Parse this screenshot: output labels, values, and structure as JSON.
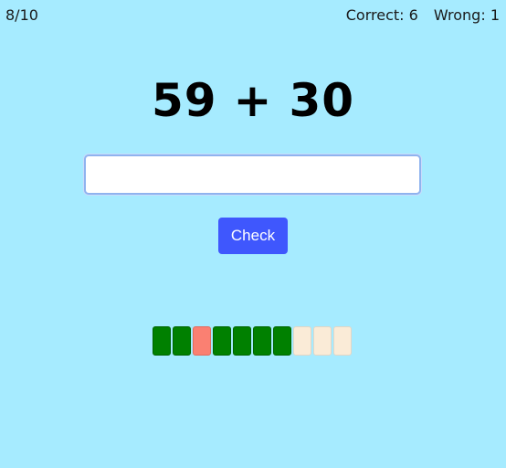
{
  "header": {
    "progress": "8/10",
    "correct_label": "Correct:",
    "correct_count": "6",
    "wrong_label": "Wrong:",
    "wrong_count": "1"
  },
  "problem": {
    "left_operand": "59",
    "operator": "+",
    "right_operand": "30"
  },
  "answer_input": {
    "value": "",
    "placeholder": ""
  },
  "check_button": {
    "label": "Check"
  },
  "results": [
    "correct",
    "correct",
    "wrong",
    "correct",
    "correct",
    "correct",
    "correct",
    "pending",
    "pending",
    "pending"
  ],
  "colors": {
    "background": "#a6ebff",
    "correct": "#008000",
    "wrong": "#fa8072",
    "pending": "#faebd7",
    "button": "#3f57fd"
  }
}
